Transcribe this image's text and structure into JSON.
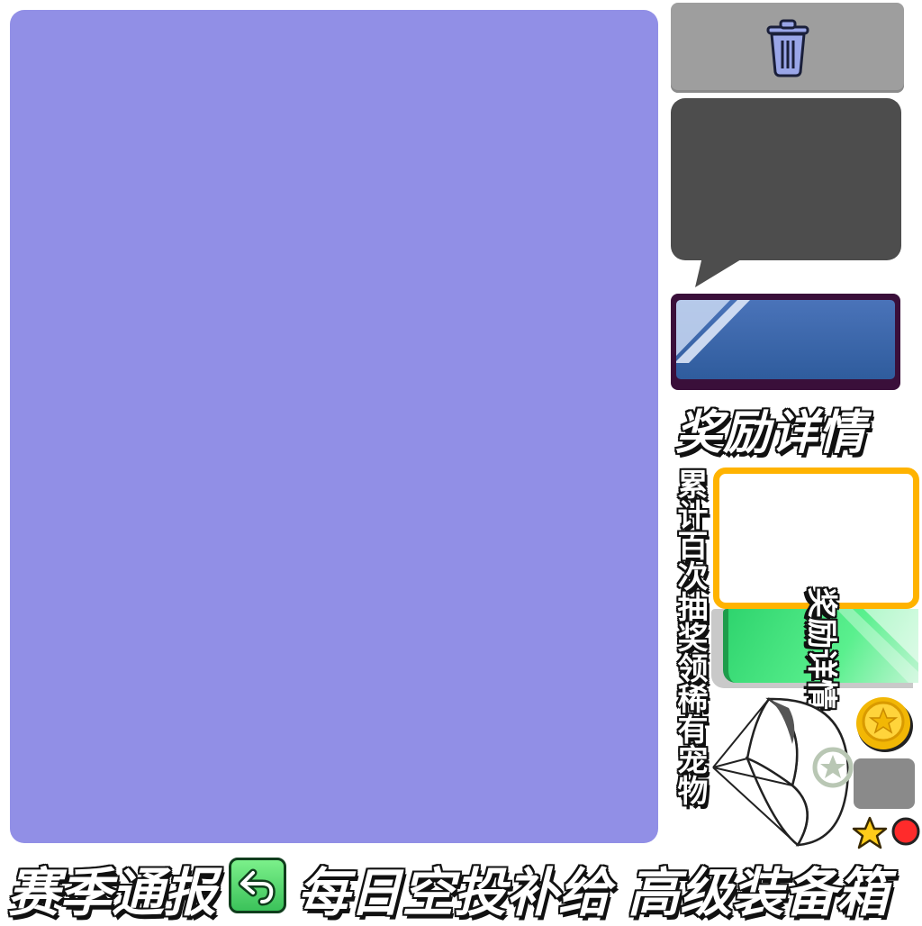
{
  "panel": {
    "color": "#918fe6"
  },
  "toolbar": {
    "trash_icon": "trash-icon",
    "trash_button_color": "#9e9e9e"
  },
  "bubble": {
    "color": "#4d4d4d"
  },
  "blue_button": {
    "color": "#3a6aad",
    "border_color": "#3a0f3a"
  },
  "reward_details": {
    "title": "奖励详情"
  },
  "accumulate": {
    "caption": "累计百次抽奖领稀有宠物"
  },
  "card": {
    "border_color": "#ffb300"
  },
  "green_tab": {
    "label": "奖励详情"
  },
  "icons": [
    "parachute-icon",
    "coin-icon",
    "star-icon",
    "red-dot-icon",
    "back-arrow-icon"
  ],
  "bottom": {
    "season_report": "赛季通报",
    "daily_airdrop": "每日空投补给",
    "advanced_crate": "高级装备箱"
  }
}
